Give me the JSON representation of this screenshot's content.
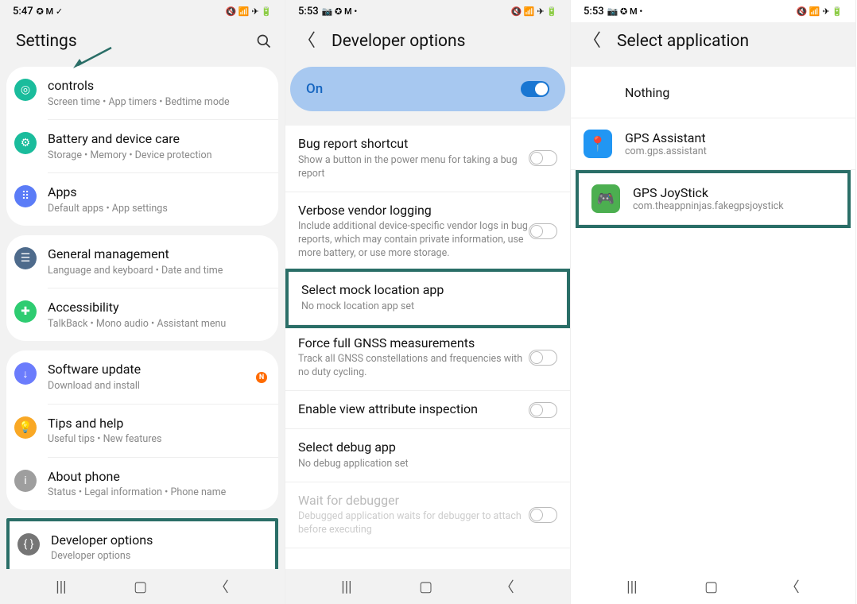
{
  "screen1": {
    "status": {
      "time": "5:47",
      "left_icons": "✪ M ✓",
      "right_icons": "🔇 📶 ✈ 🔋"
    },
    "title": "Settings",
    "groups": [
      {
        "items": [
          {
            "icon_bg": "#1abc9c",
            "icon": "◎",
            "title": "controls",
            "sub": "Screen time  •  App timers  •  Bedtime mode"
          },
          {
            "icon_bg": "#1abc9c",
            "icon": "⚙",
            "title": "Battery and device care",
            "sub": "Storage  •  Memory  •  Device protection"
          },
          {
            "icon_bg": "#5b7cf7",
            "icon": "⠿",
            "title": "Apps",
            "sub": "Default apps  •  App settings"
          }
        ]
      },
      {
        "items": [
          {
            "icon_bg": "#4e6b8c",
            "icon": "☰",
            "title": "General management",
            "sub": "Language and keyboard  •  Date and time"
          },
          {
            "icon_bg": "#2ecc71",
            "icon": "✚",
            "title": "Accessibility",
            "sub": "TalkBack  •  Mono audio  •  Assistant menu"
          }
        ]
      },
      {
        "items": [
          {
            "icon_bg": "#6b7cfc",
            "icon": "↓",
            "title": "Software update",
            "sub": "Download and install",
            "badge": "N"
          },
          {
            "icon_bg": "#f9a825",
            "icon": "💡",
            "title": "Tips and help",
            "sub": "Useful tips  •  New features"
          },
          {
            "icon_bg": "#9e9e9e",
            "icon": "i",
            "title": "About phone",
            "sub": "Status  •  Legal information  •  Phone name"
          }
        ]
      },
      {
        "highlight": true,
        "items": [
          {
            "icon_bg": "#757575",
            "icon": "{ }",
            "title": "Developer options",
            "sub": "Developer options"
          }
        ]
      }
    ]
  },
  "screen2": {
    "status": {
      "time": "5:53",
      "left_icons": "📷 ✪ M •",
      "right_icons": "🔇 📶 ✈ 🔋"
    },
    "title": "Developer options",
    "master_toggle": {
      "label": "On",
      "value": true
    },
    "items": [
      {
        "title": "Bug report shortcut",
        "sub": "Show a button in the power menu for taking a bug report",
        "toggle": false
      },
      {
        "title": "Verbose vendor logging",
        "sub": "Include additional device-specific vendor logs in bug reports, which may contain private information, use more battery, or use more storage.",
        "toggle": false
      },
      {
        "title": "Select mock location app",
        "sub": "No mock location app set",
        "highlight": true
      },
      {
        "title": "Force full GNSS measurements",
        "sub": "Track all GNSS constellations and frequencies with no duty cycling.",
        "toggle": false
      },
      {
        "title": "Enable view attribute inspection",
        "toggle": false
      },
      {
        "title": "Select debug app",
        "sub": "No debug application set"
      },
      {
        "title": "Wait for debugger",
        "sub": "Debugged application waits for debugger to attach before executing",
        "toggle": false,
        "disabled": true
      }
    ]
  },
  "screen3": {
    "status": {
      "time": "5:53",
      "left_icons": "📷 ✪ M •",
      "right_icons": "🔇 📶 ✈ 🔋"
    },
    "title": "Select application",
    "apps": [
      {
        "title": "Nothing",
        "noicon": true
      },
      {
        "icon_bg": "#2196f3",
        "icon": "📍",
        "title": "GPS Assistant",
        "sub": "com.gps.assistant"
      },
      {
        "icon_bg": "#4caf50",
        "icon": "🎮",
        "title": "GPS JoyStick",
        "sub": "com.theappninjas.fakegpsjoystick",
        "highlight": true
      }
    ]
  }
}
